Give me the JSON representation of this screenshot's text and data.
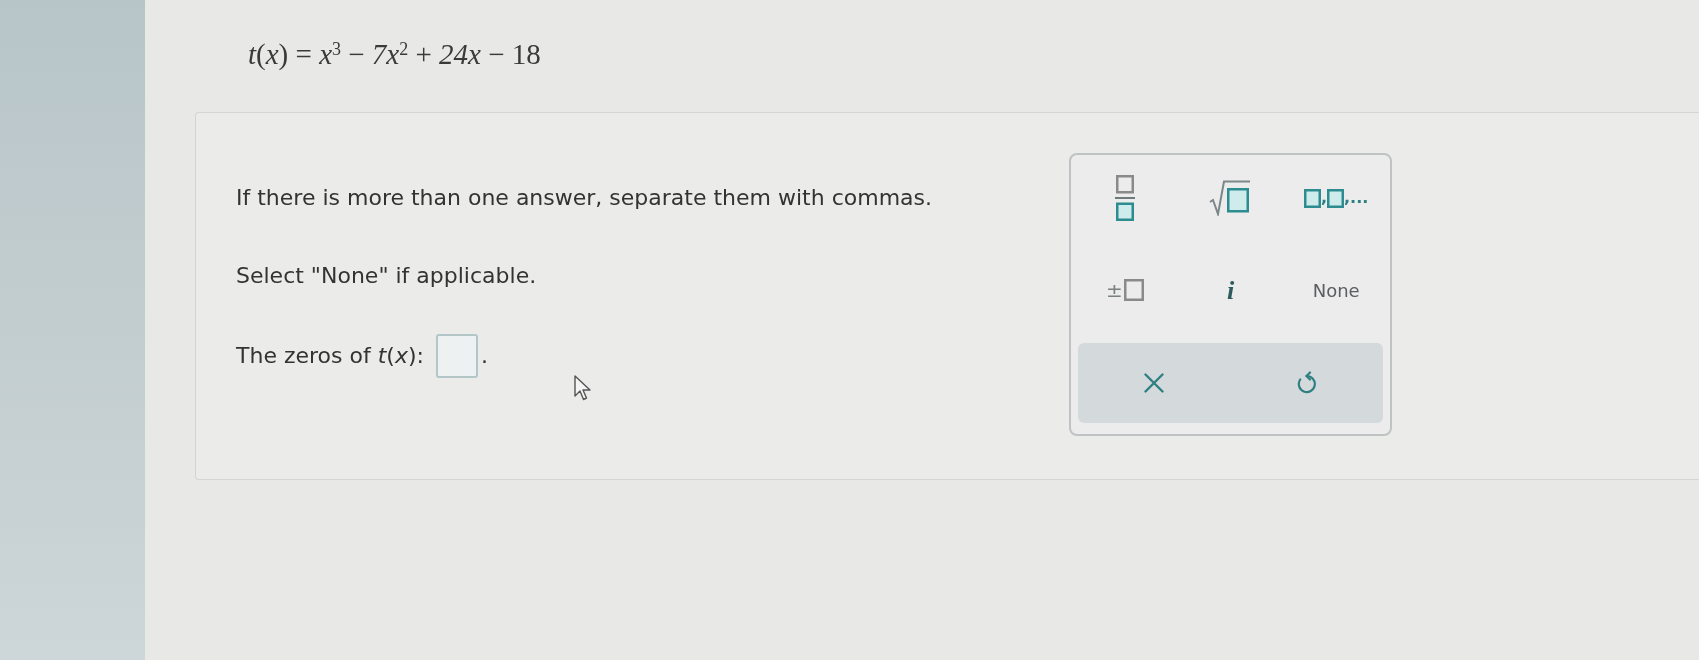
{
  "equation": "*t*(*x*) = *x*$^{3}$ − *7x*$^{2}$ + *24x* − 18",
  "question": {
    "instructions": [
      "If there is more than one answer, separate them with commas.",
      "Select \"None\" if applicable."
    ],
    "prompt": "The zeros of *t*(*x*):",
    "prompt_end": "."
  },
  "keypad": {
    "keys": [
      {
        "kind": "fraction"
      },
      {
        "kind": "sqrt"
      },
      {
        "kind": "list",
        "parts": [
          ",",
          ",..."
        ]
      },
      {
        "kind": "plus_minus",
        "symbol": "±"
      },
      {
        "kind": "imaginary",
        "label": "i"
      },
      {
        "kind": "text",
        "label": "None"
      }
    ],
    "actions": [
      {
        "kind": "clear"
      },
      {
        "kind": "undo"
      }
    ]
  }
}
